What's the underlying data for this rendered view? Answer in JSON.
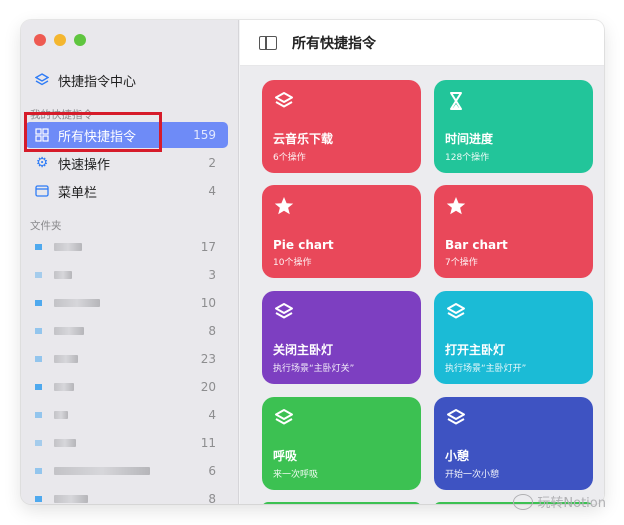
{
  "sidebar": {
    "top_item": {
      "label": "快捷指令中心"
    },
    "section_my": "我的快捷指令",
    "items": [
      {
        "label": "所有快捷指令",
        "count": "159",
        "icon": "grid-icon"
      },
      {
        "label": "快速操作",
        "count": "2",
        "icon": "gear-icon"
      },
      {
        "label": "菜单栏",
        "count": "4",
        "icon": "menubar-icon"
      }
    ],
    "section_folders": "文件夹",
    "folders": [
      {
        "count": "17"
      },
      {
        "count": "3"
      },
      {
        "count": "10"
      },
      {
        "count": "8"
      },
      {
        "count": "23"
      },
      {
        "count": "20"
      },
      {
        "count": "4"
      },
      {
        "count": "11"
      },
      {
        "count": "6"
      },
      {
        "count": "8"
      }
    ]
  },
  "toolbar": {
    "title": "所有快捷指令"
  },
  "cards": [
    {
      "name": "云音乐下载",
      "sub": "6个操作",
      "icon": "layers-icon",
      "color": "#e9485a"
    },
    {
      "name": "时间进度",
      "sub": "128个操作",
      "icon": "hourglass-icon",
      "color": "#22c59a"
    },
    {
      "name": "Pie chart",
      "sub": "10个操作",
      "icon": "star-icon",
      "color": "#e9485a"
    },
    {
      "name": "Bar chart",
      "sub": "7个操作",
      "icon": "star-icon",
      "color": "#e9485a"
    },
    {
      "name": "关闭主卧灯",
      "sub": "执行场景“主卧灯关”",
      "icon": "layers-icon",
      "color": "#7d3fc1"
    },
    {
      "name": "打开主卧灯",
      "sub": "执行场景“主卧灯开”",
      "icon": "layers-icon",
      "color": "#1bbbd6"
    },
    {
      "name": "呼吸",
      "sub": "来一次呼吸",
      "icon": "layers-icon",
      "color": "#3cc152"
    },
    {
      "name": "小憩",
      "sub": "开始一次小憩",
      "icon": "layers-icon",
      "color": "#3e53c2"
    }
  ],
  "watermark": "玩转Notion"
}
